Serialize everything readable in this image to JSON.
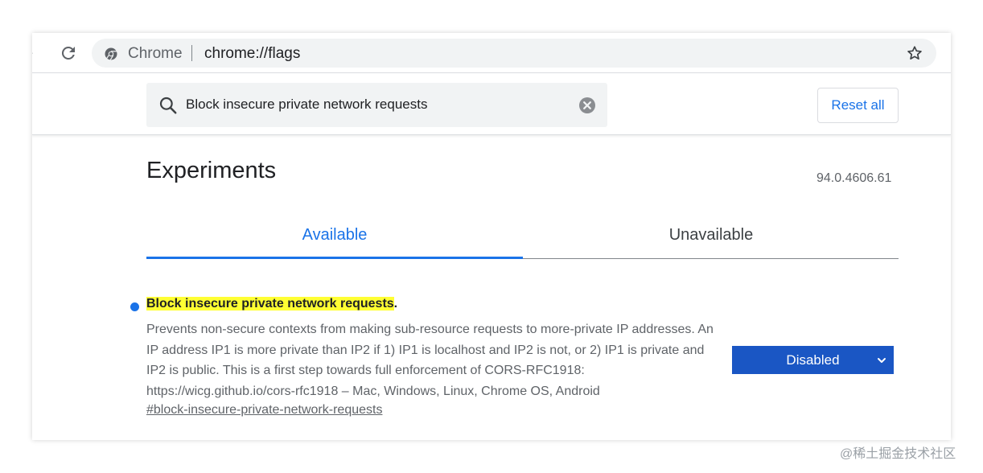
{
  "browser": {
    "app_name": "Chrome",
    "url": "chrome://flags",
    "icons": {
      "forward": "forward-arrow-icon",
      "reload": "reload-icon",
      "site": "chrome-logo-icon",
      "bookmark": "star-icon"
    }
  },
  "header": {
    "search_value": "Block insecure private network requests",
    "reset_label": "Reset all"
  },
  "main": {
    "title": "Experiments",
    "version": "94.0.4606.61",
    "tabs": [
      {
        "label": "Available",
        "selected": true
      },
      {
        "label": "Unavailable",
        "selected": false
      }
    ]
  },
  "flag": {
    "title_highlight": "Block insecure private network requests",
    "title_suffix": ".",
    "description": "Prevents non-secure contexts from making sub-resource requests to more-private IP addresses. An IP address IP1 is more private than IP2 if 1) IP1 is localhost and IP2 is not, or 2) IP1 is private and IP2 is public. This is a first step towards full enforcement of CORS-RFC1918: https://wicg.github.io/cors-rfc1918 – Mac, Windows, Linux, Chrome OS, Android",
    "link": "#block-insecure-private-network-requests",
    "selected_option": "Disabled"
  },
  "watermark": "@稀土掘金技术社区",
  "colors": {
    "accent": "#1a73e8",
    "select_bg": "#1a56c4",
    "highlight": "#ffff33"
  }
}
